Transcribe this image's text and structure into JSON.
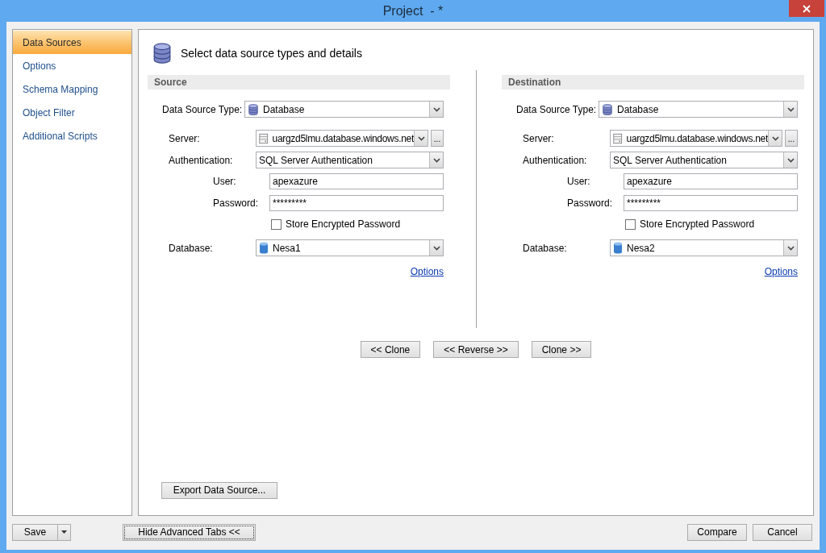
{
  "window": {
    "title": "Project  - *"
  },
  "sidebar": {
    "items": [
      {
        "label": "Data Sources",
        "selected": true
      },
      {
        "label": "Options",
        "selected": false
      },
      {
        "label": "Schema Mapping",
        "selected": false
      },
      {
        "label": "Object Filter",
        "selected": false
      },
      {
        "label": "Additional Scripts",
        "selected": false
      }
    ]
  },
  "header": {
    "title": "Select data source types and details"
  },
  "panels": [
    {
      "heading": "Source",
      "data_source_type": {
        "label": "Data Source Type:",
        "value": "Database"
      },
      "server": {
        "label": "Server:",
        "value": "uargzd5lmu.database.windows.net",
        "browse": "..."
      },
      "authentication": {
        "label": "Authentication:",
        "value": "SQL Server Authentication"
      },
      "user": {
        "label": "User:",
        "value": "apexazure"
      },
      "password": {
        "label": "Password:",
        "value": "*********"
      },
      "store_encrypted_password": {
        "label": "Store Encrypted Password",
        "checked": false
      },
      "database": {
        "label": "Database:",
        "value": "Nesa1"
      },
      "options_link": "Options"
    },
    {
      "heading": "Destination",
      "data_source_type": {
        "label": "Data Source Type:",
        "value": "Database"
      },
      "server": {
        "label": "Server:",
        "value": "uargzd5lmu.database.windows.net",
        "browse": "..."
      },
      "authentication": {
        "label": "Authentication:",
        "value": "SQL Server Authentication"
      },
      "user": {
        "label": "User:",
        "value": "apexazure"
      },
      "password": {
        "label": "Password:",
        "value": "*********"
      },
      "store_encrypted_password": {
        "label": "Store Encrypted Password",
        "checked": false
      },
      "database": {
        "label": "Database:",
        "value": "Nesa2"
      },
      "options_link": "Options"
    }
  ],
  "clone_buttons": [
    "<< Clone",
    "<< Reverse >>",
    "Clone >>"
  ],
  "export_button": "Export Data Source...",
  "footer": {
    "save": "Save",
    "hide_advanced": "Hide Advanced Tabs <<",
    "compare": "Compare",
    "cancel": "Cancel"
  }
}
